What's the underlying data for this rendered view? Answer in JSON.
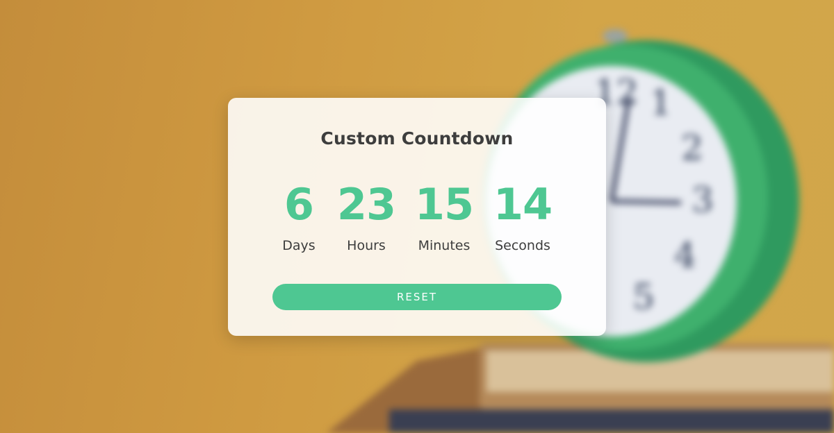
{
  "countdown": {
    "title": "Custom Countdown",
    "units": [
      {
        "value": "6",
        "label": "Days"
      },
      {
        "value": "23",
        "label": "Hours"
      },
      {
        "value": "15",
        "label": "Minutes"
      },
      {
        "value": "14",
        "label": "Seconds"
      }
    ],
    "reset_label": "RESET"
  },
  "colors": {
    "accent": "#4ec792",
    "text": "#3d3d3d",
    "background": "#d1a048",
    "clock_body": "#3aa86a"
  },
  "background_image": "blurred-alarm-clock-on-books"
}
